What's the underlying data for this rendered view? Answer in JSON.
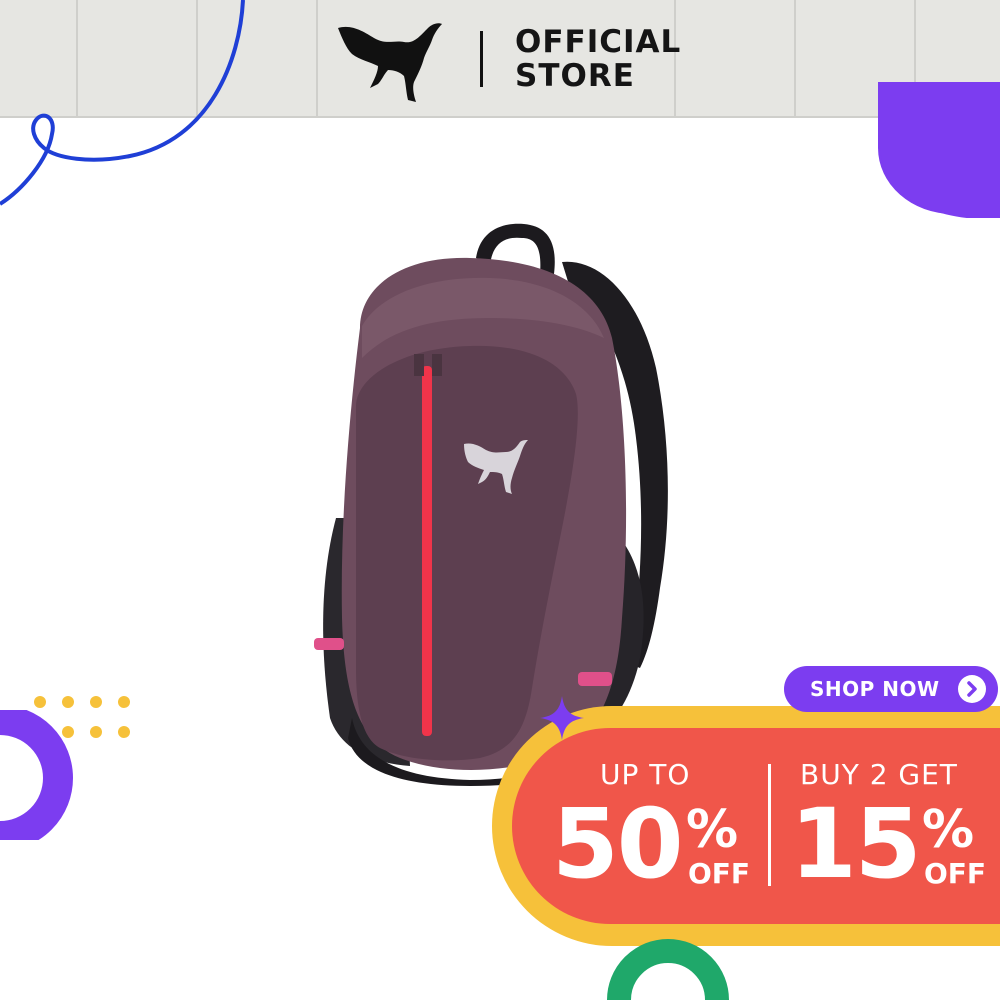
{
  "header": {
    "brand_line1": "OFFICIAL",
    "brand_line2": "STORE",
    "logo_icon": "puma-cat-icon"
  },
  "product": {
    "image_icon": "backpack-image",
    "logo_icon": "puma-cat-icon"
  },
  "promo": {
    "cta_label": "SHOP NOW",
    "cta_icon": "chevron-right-icon",
    "offer1": {
      "top": "UP TO",
      "value": "50",
      "percent": "%",
      "suffix": "OFF"
    },
    "offer2": {
      "top": "BUY 2 GET",
      "value": "15",
      "percent": "%",
      "suffix": "OFF"
    }
  },
  "colors": {
    "header_bg": "#e6e6e2",
    "accent_purple": "#7c3df0",
    "promo_yellow": "#f6c13a",
    "promo_red": "#f0564a",
    "accent_green": "#1fa86a",
    "line_blue": "#1f3fd6"
  }
}
